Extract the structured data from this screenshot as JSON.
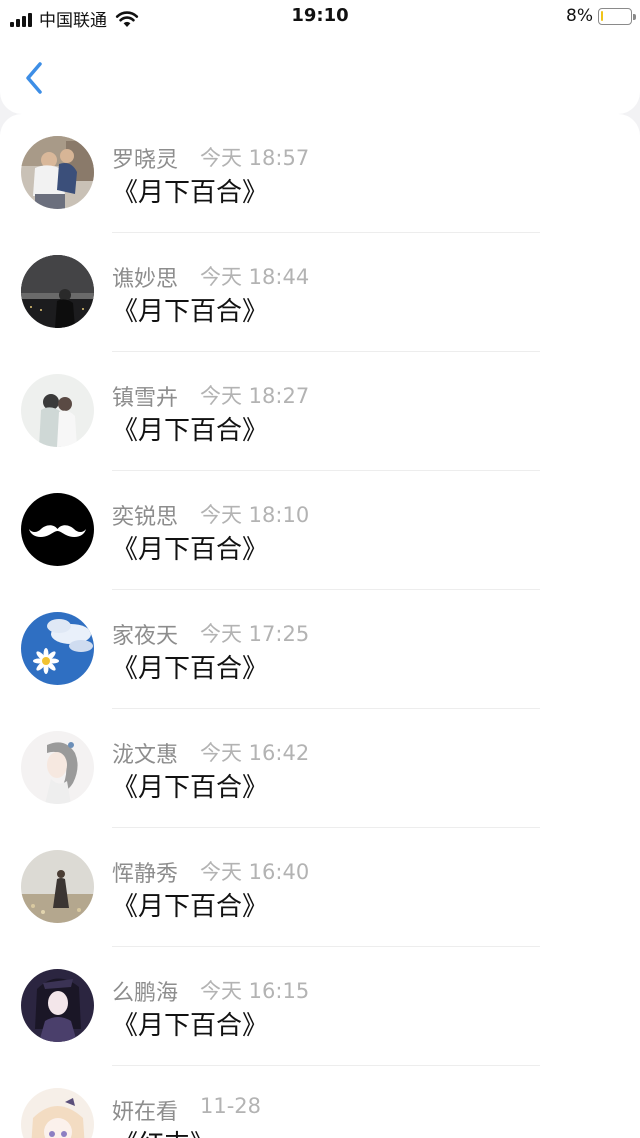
{
  "status_bar": {
    "carrier": "中国联通",
    "time": "19:10",
    "battery": "8%",
    "battery_level": 0.08,
    "icons": [
      "signal-icon",
      "wifi-icon",
      "battery-icon"
    ]
  },
  "nav": {
    "back_icon": "chevron-left-icon",
    "accent": "#3d8ee6"
  },
  "items": [
    {
      "name": "罗晓灵",
      "time": "今天 18:57",
      "content": "《月下百合》"
    },
    {
      "name": "谯妙思",
      "time": "今天 18:44",
      "content": "《月下百合》"
    },
    {
      "name": "镇雪卉",
      "time": "今天 18:27",
      "content": "《月下百合》"
    },
    {
      "name": "奕锐思",
      "time": "今天 18:10",
      "content": "《月下百合》"
    },
    {
      "name": "家夜天",
      "time": "今天 17:25",
      "content": "《月下百合》"
    },
    {
      "name": "泷文惠",
      "time": "今天 16:42",
      "content": "《月下百合》"
    },
    {
      "name": "恽静秀",
      "time": "今天 16:40",
      "content": "《月下百合》"
    },
    {
      "name": "么鹏海",
      "time": "今天 16:15",
      "content": "《月下百合》"
    },
    {
      "name": "妍在看",
      "time": "11-28",
      "content": "《红支》"
    }
  ]
}
